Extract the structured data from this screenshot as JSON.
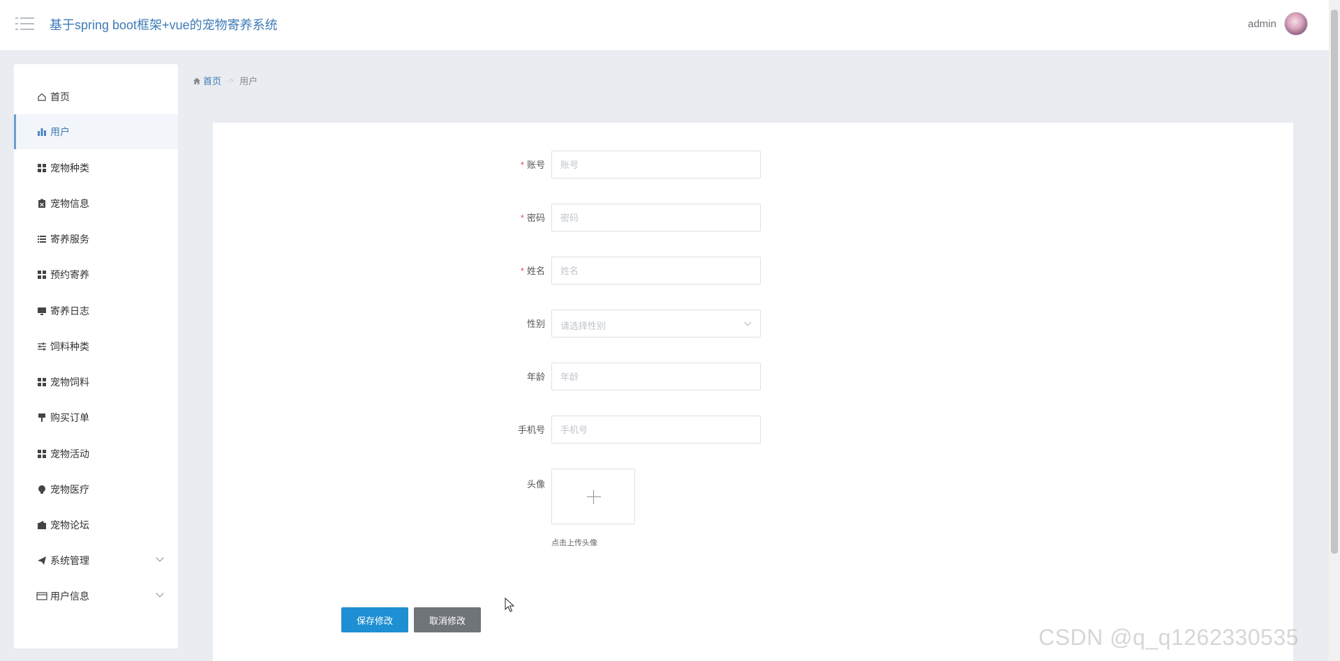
{
  "header": {
    "title": "基于spring boot框架+vue的宠物寄养系统",
    "user_name": "admin"
  },
  "sidebar": {
    "items": [
      {
        "label": "首页",
        "icon": "home-icon"
      },
      {
        "label": "用户",
        "icon": "bar-chart-icon",
        "active": true
      },
      {
        "label": "宠物种类",
        "icon": "grid-icon"
      },
      {
        "label": "宠物信息",
        "icon": "clipboard-icon"
      },
      {
        "label": "寄养服务",
        "icon": "list-icon"
      },
      {
        "label": "预约寄养",
        "icon": "grid-icon"
      },
      {
        "label": "寄养日志",
        "icon": "monitor-icon"
      },
      {
        "label": "饲料种类",
        "icon": "sliders-icon"
      },
      {
        "label": "宠物饲料",
        "icon": "grid-icon"
      },
      {
        "label": "购买订单",
        "icon": "brush-icon"
      },
      {
        "label": "宠物活动",
        "icon": "grid-icon"
      },
      {
        "label": "宠物医疗",
        "icon": "lightbulb-icon"
      },
      {
        "label": "宠物论坛",
        "icon": "wallet-icon"
      },
      {
        "label": "系统管理",
        "icon": "send-icon",
        "expandable": true
      },
      {
        "label": "用户信息",
        "icon": "card-icon",
        "expandable": true
      }
    ]
  },
  "breadcrumb": {
    "home": "首页",
    "separator": "->",
    "current": "用户"
  },
  "form": {
    "account": {
      "label": "账号",
      "placeholder": "账号",
      "required": true
    },
    "password": {
      "label": "密码",
      "placeholder": "密码",
      "required": true
    },
    "name": {
      "label": "姓名",
      "placeholder": "姓名",
      "required": true
    },
    "gender": {
      "label": "性别",
      "placeholder": "请选择性别"
    },
    "age": {
      "label": "年龄",
      "placeholder": "年龄"
    },
    "phone": {
      "label": "手机号",
      "placeholder": "手机号"
    },
    "avatar": {
      "label": "头像",
      "hint": "点击上传头像"
    },
    "required_mark": "*",
    "save_label": "保存修改",
    "cancel_label": "取消修改"
  },
  "watermark": "CSDN @q_q1262330535",
  "colors": {
    "accent": "#1e8fd2",
    "title": "#3e7bb6",
    "required": "#e34d4d",
    "cancel": "#6f7479",
    "background": "#e9ecf1"
  }
}
